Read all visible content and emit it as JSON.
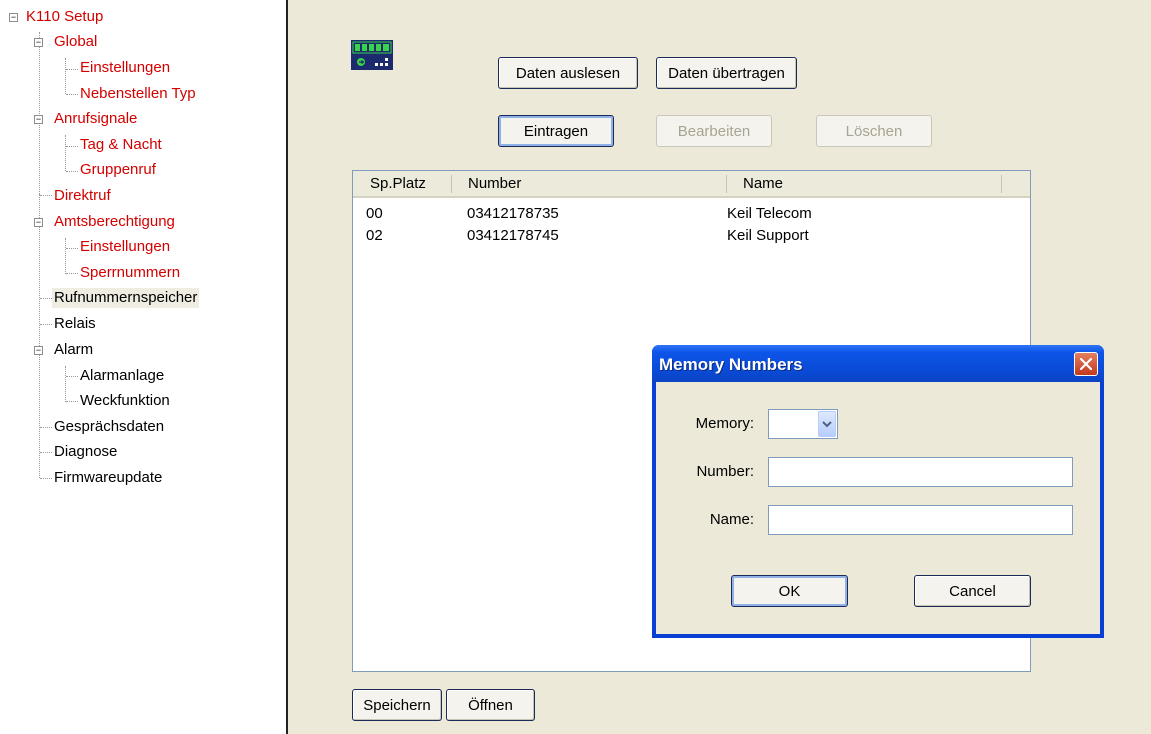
{
  "tree": {
    "root": "K110 Setup",
    "items": [
      "Global",
      "Einstellungen",
      "Nebenstellen Typ",
      "Anrufsignale",
      "Tag & Nacht",
      "Gruppenruf",
      "Direktruf",
      "Amtsberechtigung",
      "Einstellungen",
      "Sperrnummern",
      "Rufnummernspeicher",
      "Relais",
      "Alarm",
      "Alarmanlage",
      "Weckfunktion",
      "Gesprächsdaten",
      "Diagnose",
      "Firmwareupdate"
    ],
    "selected": "Rufnummernspeicher"
  },
  "toolbar": {
    "read_label": "Daten auslesen",
    "transfer_label": "Daten übertragen",
    "add_label": "Eintragen",
    "edit_label": "Bearbeiten",
    "delete_label": "Löschen"
  },
  "list": {
    "columns": [
      "Sp.Platz",
      "Number",
      "Name"
    ],
    "rows": [
      {
        "slot": "00",
        "number": "03412178735",
        "name": "Keil Telecom"
      },
      {
        "slot": "02",
        "number": "03412178745",
        "name": "Keil Support"
      }
    ]
  },
  "footer": {
    "save_label": "Speichern",
    "open_label": "Öffnen"
  },
  "dialog": {
    "title": "Memory Numbers",
    "memory_label": "Memory:",
    "memory_value": "",
    "number_label": "Number:",
    "number_value": "",
    "name_label": "Name:",
    "name_value": "",
    "ok_label": "OK",
    "cancel_label": "Cancel"
  },
  "colors": {
    "tree_red": "#d40000",
    "title_blue": "#0a4ad6",
    "panel_bg": "#ece9d8"
  }
}
